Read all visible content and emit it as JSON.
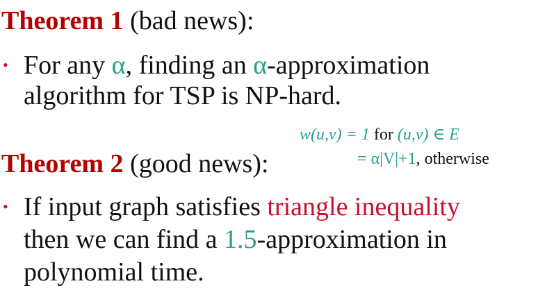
{
  "theorem1": {
    "title": "Theorem 1",
    "subtitle": " (bad news):",
    "bullet": "•",
    "line1_a": "For any ",
    "line1_alpha1": "α",
    "line1_b": ", finding an ",
    "line1_alpha2": "α",
    "line1_c": "-approximation",
    "line2": "algorithm for TSP is NP-hard."
  },
  "formula": {
    "line1_lhs": "w(u,v) = 1",
    "line1_for": " for ",
    "line1_rhs": "(u,v) ∈ E",
    "line2_lhs": "= α|V|+1",
    "line2_tail": ", otherwise"
  },
  "theorem2": {
    "title": "Theorem 2",
    "subtitle": " (good news):",
    "bullet": "•",
    "line1_a": "If input graph satisfies ",
    "line1_highlight": "triangle inequality",
    "line2_a": "then we can find a ",
    "line2_value": "1.5",
    "line2_b": "-approximation in",
    "line3": "polynomial time."
  },
  "colors": {
    "theorem_title": "#b30000",
    "highlight_red": "#c8102e",
    "math_teal": "#2a9d8f"
  }
}
